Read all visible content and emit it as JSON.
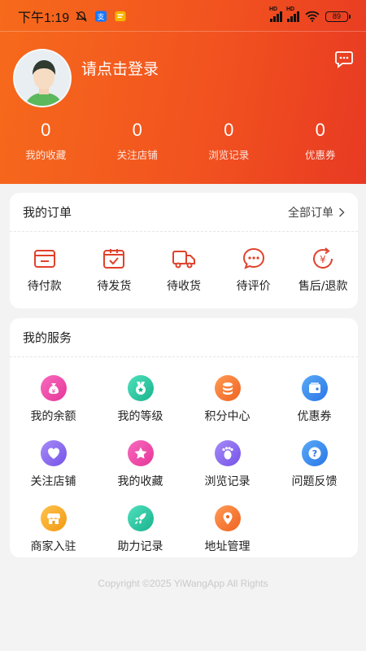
{
  "status_bar": {
    "time": "下午1:19",
    "battery": "89",
    "hd1": "HD",
    "hd2": "HD"
  },
  "header": {
    "login_text": "请点击登录",
    "stats": [
      {
        "value": "0",
        "label": "我的收藏"
      },
      {
        "value": "0",
        "label": "关注店铺"
      },
      {
        "value": "0",
        "label": "浏览记录"
      },
      {
        "value": "0",
        "label": "优惠券"
      }
    ]
  },
  "orders": {
    "title": "我的订单",
    "all_label": "全部订单",
    "items": [
      {
        "label": "待付款",
        "icon": "wallet-icon"
      },
      {
        "label": "待发货",
        "icon": "package-icon"
      },
      {
        "label": "待收货",
        "icon": "truck-icon"
      },
      {
        "label": "待评价",
        "icon": "comment-icon"
      },
      {
        "label": "售后/退款",
        "icon": "refund-icon"
      }
    ]
  },
  "services": {
    "title": "我的服务",
    "items": [
      {
        "label": "我的余额",
        "icon": "money-bag-icon",
        "color": "#ec4aa6"
      },
      {
        "label": "我的等级",
        "icon": "medal-icon",
        "color": "#2fc9a5"
      },
      {
        "label": "积分中心",
        "icon": "coins-icon",
        "color": "#f47a2c"
      },
      {
        "label": "优惠券",
        "icon": "coupon-icon",
        "color": "#3a8ef0"
      },
      {
        "label": "关注店铺",
        "icon": "heart-icon",
        "color": "#8b6cf0"
      },
      {
        "label": "我的收藏",
        "icon": "star-icon",
        "color": "#ec4aa6"
      },
      {
        "label": "浏览记录",
        "icon": "footprint-icon",
        "color": "#8b6cf0"
      },
      {
        "label": "问题反馈",
        "icon": "question-icon",
        "color": "#3a8ef0"
      },
      {
        "label": "商家入驻",
        "icon": "shop-icon",
        "color": "#f5a623"
      },
      {
        "label": "助力记录",
        "icon": "rocket-icon",
        "color": "#2fc9a5"
      },
      {
        "label": "地址管理",
        "icon": "location-icon",
        "color": "#f47a2c"
      }
    ]
  },
  "footer": {
    "copyright": "Copyright ©2025 YiWangApp All Rights"
  },
  "colors": {
    "header_start": "#f66a1c",
    "header_end": "#e83a23",
    "order_icon": "#e0412b"
  }
}
